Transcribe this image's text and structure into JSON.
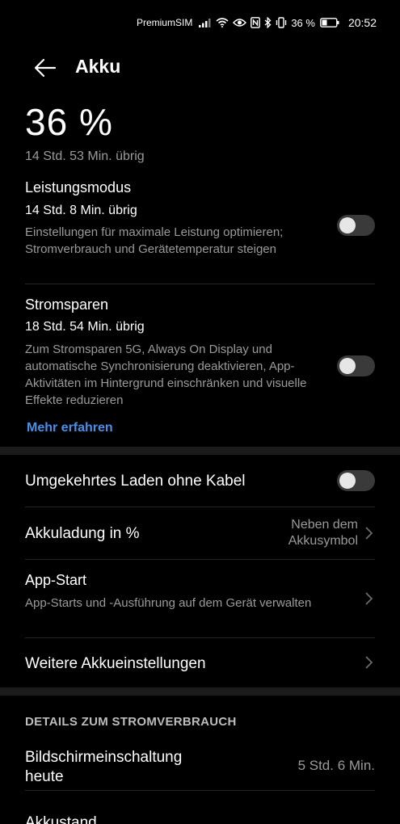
{
  "status_bar": {
    "carrier": "PremiumSIM",
    "battery_percent": "36 %",
    "time": "20:52"
  },
  "header": {
    "title": "Akku"
  },
  "battery": {
    "percent": "36 %",
    "remaining": "14 Std. 53 Min. übrig"
  },
  "performance_mode": {
    "title": "Leistungsmodus",
    "remaining": "14 Std. 8 Min. übrig",
    "description": "Einstellungen für maximale Leistung optimieren; Stromverbrauch und Gerätetemperatur steigen",
    "enabled": false
  },
  "power_saving": {
    "title": "Stromsparen",
    "remaining": "18 Std. 54 Min. übrig",
    "description": "Zum Stromsparen 5G, Always On Display und automatische Synchronisierung deaktivieren, App-Aktivitäten im Hintergrund einschränken und visuelle Effekte reduzieren",
    "enabled": false
  },
  "learn_more": "Mehr erfahren",
  "reverse_charging": {
    "title": "Umgekehrtes Laden ohne Kabel",
    "enabled": false
  },
  "battery_percentage": {
    "title": "Akkuladung in %",
    "value_line1": "Neben dem",
    "value_line2": "Akkusymbol"
  },
  "app_launch": {
    "title": "App-Start",
    "description": "App-Starts und -Ausführung auf dem Gerät verwalten"
  },
  "more_settings": {
    "title": "Weitere Akkueinstellungen"
  },
  "details": {
    "header": "DETAILS ZUM STROMVERBRAUCH",
    "screen_on_title_line1": "Bildschirmeinschaltung",
    "screen_on_title_line2": "heute",
    "screen_on_value": "5 Std. 6 Min.",
    "battery_level_title": "Akkustand"
  },
  "colors": {
    "background": "#000000",
    "accent": "#4a8fe8",
    "secondary_text": "#9a9a9a",
    "toggle_off": "#3a3a3a"
  }
}
